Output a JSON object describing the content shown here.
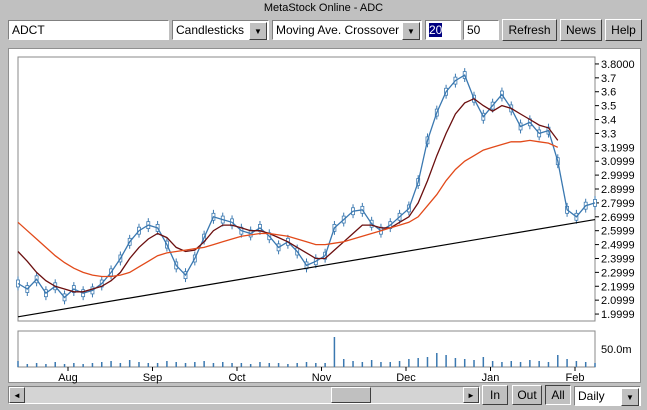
{
  "window": {
    "title": "MetaStock Online - ADC"
  },
  "toolbar": {
    "symbol": "ADCT",
    "chart_style": "Candlesticks",
    "indicator": "Moving Ave. Crossover",
    "fast_period": "20",
    "slow_period": "50",
    "refresh_label": "Refresh",
    "news_label": "News",
    "help_label": "Help"
  },
  "footer": {
    "in_label": "In",
    "out_label": "Out",
    "all_label": "All",
    "period": "Daily",
    "left_arrow": "◄",
    "right_arrow": "►",
    "dropdown_arrow": "▼"
  },
  "colors": {
    "short_ma": "#6b0f0f",
    "long_ma": "#e24a1a",
    "price": "#3a78b0",
    "trendline": "#000000"
  },
  "chart_data": {
    "type": "line",
    "title": "",
    "x_tick_labels": [
      "Aug",
      "Sep",
      "Oct",
      "Nov",
      "Dec",
      "Jan",
      "Feb"
    ],
    "y_tick_labels": [
      "3.8000",
      "3.7",
      "3.6",
      "3.5",
      "3.4",
      "3.3",
      "3.1999",
      "3.0999",
      "2.9999",
      "2.8999",
      "2.7999",
      "2.6999",
      "2.5999",
      "2.4999",
      "2.3999",
      "2.2999",
      "2.1999",
      "2.0999",
      "1.9999"
    ],
    "volume_label": "50.0m",
    "ylim": [
      1.95,
      3.85
    ],
    "x": [
      0,
      4,
      8,
      12,
      16,
      20,
      24,
      28,
      32,
      36,
      40,
      44,
      48,
      52,
      56,
      60,
      64,
      68,
      72,
      76,
      80,
      84,
      88,
      92,
      96,
      100,
      104,
      108,
      112,
      116,
      120,
      124,
      128,
      132,
      136,
      140,
      144,
      148,
      152,
      156,
      160,
      164,
      168,
      172,
      176,
      180,
      184,
      188,
      192,
      196,
      200,
      204,
      208,
      212,
      216,
      220,
      224,
      228,
      232,
      236,
      240,
      244,
      248
    ],
    "series": [
      {
        "values": [
          2.22,
          2.18,
          2.25,
          2.15,
          2.2,
          2.12,
          2.18,
          2.15,
          2.17,
          2.22,
          2.3,
          2.4,
          2.52,
          2.6,
          2.64,
          2.62,
          2.5,
          2.35,
          2.28,
          2.4,
          2.55,
          2.7,
          2.68,
          2.66,
          2.6,
          2.58,
          2.62,
          2.56,
          2.48,
          2.52,
          2.45,
          2.35,
          2.38,
          2.42,
          2.62,
          2.68,
          2.74,
          2.75,
          2.65,
          2.6,
          2.64,
          2.7,
          2.76,
          2.95,
          3.25,
          3.45,
          3.6,
          3.68,
          3.72,
          3.55,
          3.42,
          3.5,
          3.58,
          3.48,
          3.35,
          3.38,
          3.3,
          3.32,
          3.1,
          2.75,
          2.7,
          2.78,
          2.8
        ]
      },
      {
        "values": [
          2.45,
          2.38,
          2.3,
          2.24,
          2.2,
          2.18,
          2.16,
          2.16,
          2.18,
          2.2,
          2.24,
          2.3,
          2.4,
          2.48,
          2.54,
          2.58,
          2.55,
          2.48,
          2.45,
          2.46,
          2.52,
          2.6,
          2.64,
          2.64,
          2.62,
          2.6,
          2.6,
          2.58,
          2.55,
          2.52,
          2.48,
          2.44,
          2.4,
          2.4,
          2.46,
          2.52,
          2.58,
          2.64,
          2.64,
          2.62,
          2.62,
          2.66,
          2.7,
          2.8,
          2.96,
          3.14,
          3.3,
          3.44,
          3.52,
          3.55,
          3.5,
          3.46,
          3.5,
          3.48,
          3.44,
          3.4,
          3.36,
          3.34,
          3.25
        ]
      },
      {
        "values": [
          2.66,
          2.6,
          2.54,
          2.48,
          2.42,
          2.37,
          2.33,
          2.3,
          2.28,
          2.27,
          2.27,
          2.28,
          2.3,
          2.34,
          2.38,
          2.42,
          2.44,
          2.45,
          2.46,
          2.47,
          2.48,
          2.5,
          2.52,
          2.54,
          2.56,
          2.57,
          2.58,
          2.58,
          2.57,
          2.56,
          2.54,
          2.52,
          2.5,
          2.5,
          2.51,
          2.52,
          2.54,
          2.56,
          2.58,
          2.6,
          2.62,
          2.64,
          2.66,
          2.7,
          2.78,
          2.86,
          2.96,
          3.04,
          3.1,
          3.14,
          3.18,
          3.2,
          3.22,
          3.24,
          3.24,
          3.25,
          3.24,
          3.23,
          3.2
        ]
      }
    ],
    "volume": [
      6,
      3,
      4,
      3,
      5,
      3,
      4,
      3,
      4,
      5,
      6,
      4,
      7,
      5,
      4,
      4,
      6,
      5,
      4,
      5,
      6,
      4,
      5,
      4,
      4,
      3,
      5,
      4,
      4,
      3,
      4,
      5,
      4,
      4,
      30,
      8,
      6,
      5,
      7,
      5,
      5,
      6,
      8,
      9,
      10,
      14,
      12,
      9,
      8,
      7,
      10,
      6,
      5,
      6,
      5,
      7,
      6,
      5,
      12,
      8,
      6,
      5,
      4
    ]
  }
}
